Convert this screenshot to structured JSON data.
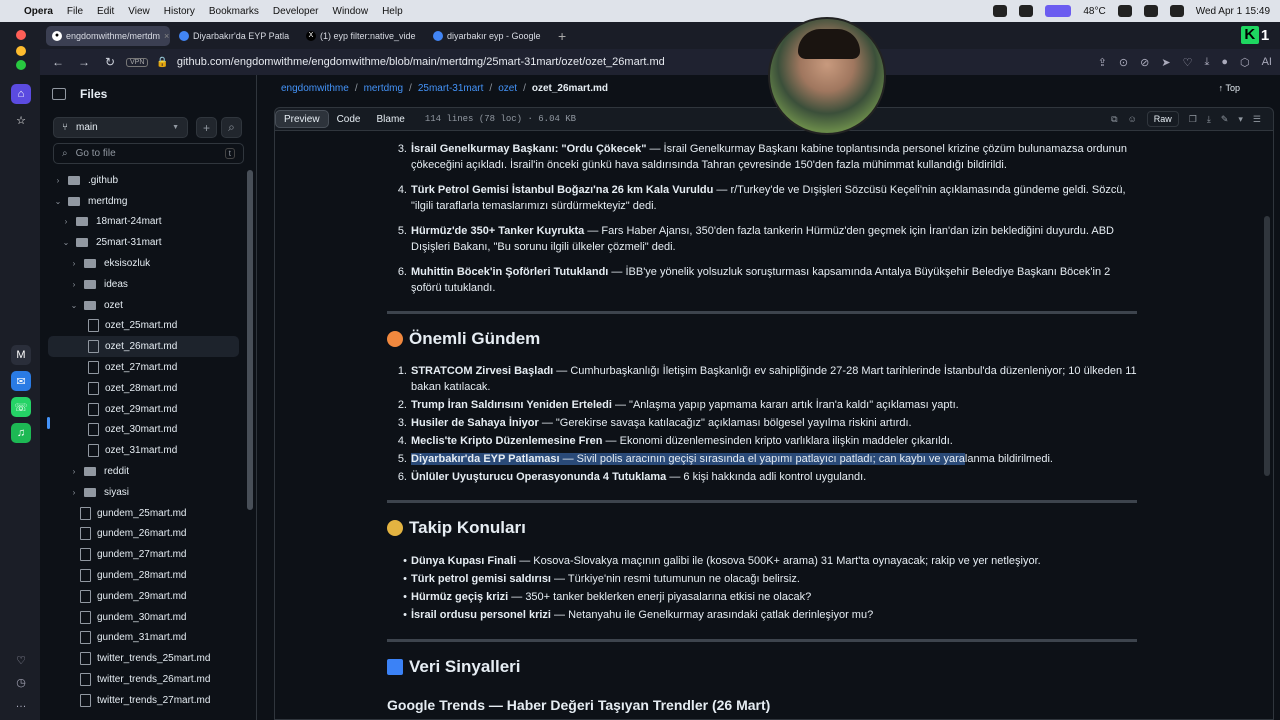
{
  "menubar": {
    "app": "Opera",
    "items": [
      "File",
      "Edit",
      "View",
      "History",
      "Bookmarks",
      "Developer",
      "Window",
      "Help"
    ],
    "temperature": "48°C",
    "datetime": "Wed Apr 1  15:49"
  },
  "tabs": [
    {
      "title": "engdomwithme/mertdm",
      "active": true
    },
    {
      "title": "Diyarbakır'da EYP Patla",
      "active": false
    },
    {
      "title": "(1) eyp filter:native_vide",
      "active": false
    },
    {
      "title": "diyarbakır eyp - Google",
      "active": false
    }
  ],
  "address": {
    "vpn": "VPN",
    "url": "github.com/engdomwithme/engdomwithme/blob/main/mertdmg/25mart-31mart/ozet/ozet_26mart.md",
    "ai": "AI"
  },
  "filepanel": {
    "title": "Files",
    "branch": "main",
    "goto_placeholder": "Go to file",
    "goto_key": "t"
  },
  "tree": [
    {
      "label": ".github",
      "type": "dir",
      "depth": 0,
      "open": false
    },
    {
      "label": "mertdmg",
      "type": "dir",
      "depth": 0,
      "open": true
    },
    {
      "label": "18mart-24mart",
      "type": "dir",
      "depth": 1,
      "open": false
    },
    {
      "label": "25mart-31mart",
      "type": "dir",
      "depth": 1,
      "open": true
    },
    {
      "label": "eksisozluk",
      "type": "dir",
      "depth": 2,
      "open": false
    },
    {
      "label": "ideas",
      "type": "dir",
      "depth": 2,
      "open": false
    },
    {
      "label": "ozet",
      "type": "dir",
      "depth": 2,
      "open": true
    },
    {
      "label": "ozet_25mart.md",
      "type": "file",
      "depth": 3
    },
    {
      "label": "ozet_26mart.md",
      "type": "file",
      "depth": 3,
      "selected": true
    },
    {
      "label": "ozet_27mart.md",
      "type": "file",
      "depth": 3
    },
    {
      "label": "ozet_28mart.md",
      "type": "file",
      "depth": 3
    },
    {
      "label": "ozet_29mart.md",
      "type": "file",
      "depth": 3
    },
    {
      "label": "ozet_30mart.md",
      "type": "file",
      "depth": 3
    },
    {
      "label": "ozet_31mart.md",
      "type": "file",
      "depth": 3
    },
    {
      "label": "reddit",
      "type": "dir",
      "depth": 2,
      "open": false
    },
    {
      "label": "siyasi",
      "type": "dir",
      "depth": 2,
      "open": false
    },
    {
      "label": "gundem_25mart.md",
      "type": "file",
      "depth": 2
    },
    {
      "label": "gundem_26mart.md",
      "type": "file",
      "depth": 2
    },
    {
      "label": "gundem_27mart.md",
      "type": "file",
      "depth": 2
    },
    {
      "label": "gundem_28mart.md",
      "type": "file",
      "depth": 2
    },
    {
      "label": "gundem_29mart.md",
      "type": "file",
      "depth": 2
    },
    {
      "label": "gundem_30mart.md",
      "type": "file",
      "depth": 2
    },
    {
      "label": "gundem_31mart.md",
      "type": "file",
      "depth": 2
    },
    {
      "label": "twitter_trends_25mart.md",
      "type": "file",
      "depth": 2
    },
    {
      "label": "twitter_trends_26mart.md",
      "type": "file",
      "depth": 2
    },
    {
      "label": "twitter_trends_27mart.md",
      "type": "file",
      "depth": 2
    }
  ],
  "breadcrumb": [
    "engdomwithme",
    "mertdmg",
    "25mart-31mart",
    "ozet",
    "ozet_26mart.md"
  ],
  "top_label": "Top",
  "toolbar": {
    "preview": "Preview",
    "code": "Code",
    "blame": "Blame",
    "info": "114 lines (78 loc) · 6.04 KB",
    "raw": "Raw"
  },
  "list1": [
    {
      "n": "3.",
      "b": "İsrail Genelkurmay Başkanı: \"Ordu Çökecek\"",
      "t": " — İsrail Genelkurmay Başkanı kabine toplantısında personel krizine çözüm bulunamazsa ordunun çökeceğini açıkladı. İsrail'in önceki günkü hava saldırısında Tahran çevresinde 150'den fazla mühimmat kullandığı bildirildi."
    },
    {
      "n": "4.",
      "b": "Türk Petrol Gemisi İstanbul Boğazı'na 26 km Kala Vuruldu",
      "t": " — r/Turkey'de ve Dışişleri Sözcüsü Keçeli'nin açıklamasında gündeme geldi. Sözcü, \"ilgili taraflarla temaslarımızı sürdürmekteyiz\" dedi."
    },
    {
      "n": "5.",
      "b": "Hürmüz'de 350+ Tanker Kuyrukta",
      "t": " — Fars Haber Ajansı, 350'den fazla tankerin Hürmüz'den geçmek için İran'dan izin beklediğini duyurdu. ABD Dışişleri Bakanı, \"Bu sorunu ilgili ülkeler çözmeli\" dedi."
    },
    {
      "n": "6.",
      "b": "Muhittin Böcek'in Şoförleri Tutuklandı",
      "t": " — İBB'ye yönelik yolsuzluk soruşturması kapsamında Antalya Büyükşehir Belediye Başkanı Böcek'in 2 şoförü tutuklandı."
    }
  ],
  "section1": "Önemli Gündem",
  "list2": [
    {
      "n": "1.",
      "b": "STRATCOM Zirvesi Başladı",
      "t": " — Cumhurbaşkanlığı İletişim Başkanlığı ev sahipliğinde 27-28 Mart tarihlerinde İstanbul'da düzenleniyor; 10 ülkeden 11 bakan katılacak."
    },
    {
      "n": "2.",
      "b": "Trump İran Saldırısını Yeniden Erteledi",
      "t": " — \"Anlaşma yapıp yapmama kararı artık İran'a kaldı\" açıklaması yaptı."
    },
    {
      "n": "3.",
      "b": "Husiler de Sahaya İniyor",
      "t": " — \"Gerekirse savaşa katılacağız\" açıklaması bölgesel yayılma riskini artırdı."
    },
    {
      "n": "4.",
      "b": "Meclis'te Kripto Düzenlemesine Fren",
      "t": " — Ekonomi düzenlemesinden kripto varlıklara ilişkin maddeler çıkarıldı."
    },
    {
      "n": "5.",
      "b": "Diyarbakır'da EYP Patlaması",
      "t": " — Sivil polis aracının geçişi sırasında el yapımı patlayıcı patladı; can kaybı ve yara",
      "t2": "lanma bildirilmedi."
    },
    {
      "n": "6.",
      "b": "Ünlüler Uyuşturucu Operasyonunda 4 Tutuklama",
      "t": " — 6 kişi hakkında adli kontrol uygulandı."
    }
  ],
  "section2": "Takip Konuları",
  "list3": [
    {
      "b": "Dünya Kupası Finali",
      "t": " — Kosova-Slovakya maçının galibi ile (kosova 500K+ arama) 31 Mart'ta oynayacak; rakip ve yer netleşiyor."
    },
    {
      "b": "Türk petrol gemisi saldırısı",
      "t": " — Türkiye'nin resmi tutumunun ne olacağı belirsiz."
    },
    {
      "b": "Hürmüz geçiş krizi",
      "t": " — 350+ tanker beklerken enerji piyasalarına etkisi ne olacak?"
    },
    {
      "b": "İsrail ordusu personel krizi",
      "t": " — Netanyahu ile Genelkurmay arasındaki çatlak derinleşiyor mu?"
    }
  ],
  "section3": "Veri Sinyalleri",
  "subsection": "Google Trends — Haber Değeri Taşıyan Trendler (26 Mart)",
  "colors": {
    "accent": "#4493f8",
    "bg": "#0d1117",
    "orange": "#f0883e",
    "yellow": "#e3b341"
  }
}
